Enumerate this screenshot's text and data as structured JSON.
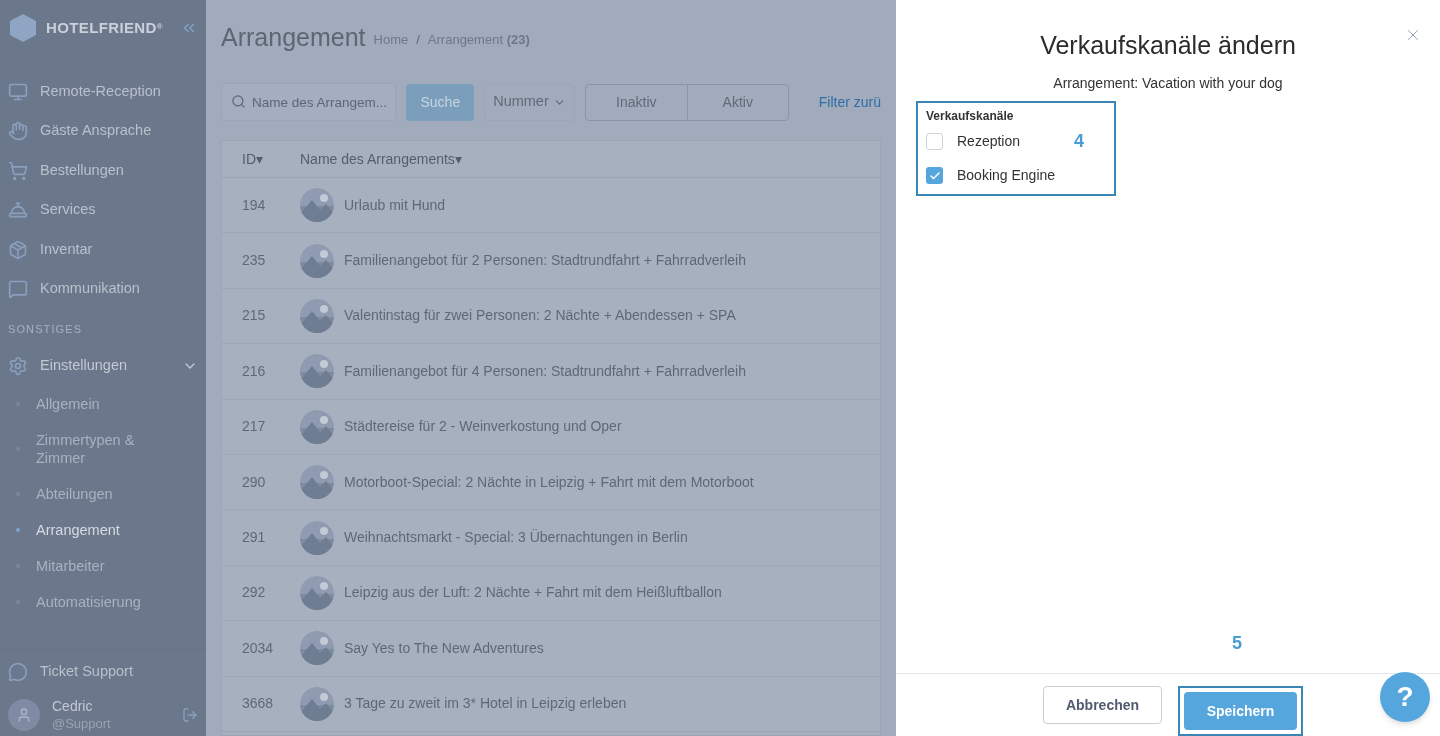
{
  "sidebar": {
    "logo": "HOTELFRIEND",
    "logo_mark": "®",
    "items": [
      {
        "label": "Remote-Reception"
      },
      {
        "label": "Gäste Ansprache"
      },
      {
        "label": "Bestellungen"
      },
      {
        "label": "Services"
      },
      {
        "label": "Inventar"
      },
      {
        "label": "Kommunikation"
      }
    ],
    "section": "SONSTIGES",
    "settings": {
      "label": "Einstellungen",
      "expanded": true,
      "children": [
        {
          "label": "Allgemein",
          "selected": false
        },
        {
          "label": "Zimmertypen & Zimmer",
          "selected": false
        },
        {
          "label": "Abteilungen",
          "selected": false
        },
        {
          "label": "Arrangement",
          "selected": true
        },
        {
          "label": "Mitarbeiter",
          "selected": false
        },
        {
          "label": "Automatisierung",
          "selected": false
        }
      ]
    },
    "support": "Ticket Support",
    "user": {
      "name": "Cedric",
      "role": "@Support"
    }
  },
  "header": {
    "title": "Arrangement",
    "breadcrumb_home": "Home",
    "breadcrumb_separator": "/",
    "breadcrumb_current": "Arrangement",
    "count": "(23)"
  },
  "toolbar": {
    "search_placeholder": "Name des Arrangem...",
    "search_button": "Suche",
    "sort": "Nummer",
    "status_tabs": [
      {
        "label": "Inaktiv",
        "selected": false
      },
      {
        "label": "Aktiv",
        "selected": false
      }
    ],
    "reset": "Filter zurü"
  },
  "table": {
    "columns": [
      "ID",
      "Name des Arrangements"
    ],
    "sort_marks": [
      "▾",
      "▾"
    ],
    "rows": [
      {
        "id": "194",
        "name": "Urlaub mit Hund"
      },
      {
        "id": "235",
        "name": "Familienangebot für 2 Personen: Stadtrundfahrt + Fahrradverleih"
      },
      {
        "id": "215",
        "name": "Valentinstag für zwei Personen: 2 Nächte + Abendessen + SPA"
      },
      {
        "id": "216",
        "name": "Familienangebot für 4 Personen: Stadtrundfahrt + Fahrradverleih"
      },
      {
        "id": "217",
        "name": "Städtereise für 2 - Weinverkostung und Oper"
      },
      {
        "id": "290",
        "name": "Motorboot-Special: 2 Nächte in Leipzig + Fahrt mit dem Motorboot"
      },
      {
        "id": "291",
        "name": "Weihnachtsmarkt - Special: 3 Übernachtungen in Berlin"
      },
      {
        "id": "292",
        "name": "Leipzig aus der Luft: 2 Nächte + Fahrt mit dem Heißluftballon"
      },
      {
        "id": "2034",
        "name": "Say Yes to The New Adventures"
      },
      {
        "id": "3668",
        "name": "3 Tage zu zweit im 3* Hotel in Leipzig erleben"
      }
    ]
  },
  "drawer": {
    "title": "Verkaufskanäle ändern",
    "subtitle": "Arrangement: Vacation with your dog",
    "group_label": "Verkaufskanäle",
    "channels": [
      {
        "label": "Rezeption",
        "checked": false
      },
      {
        "label": "Booking Engine",
        "checked": true
      }
    ],
    "annotations": [
      "4",
      "5"
    ],
    "buttons": [
      {
        "label": "Abbrechen",
        "kind": "secondary"
      },
      {
        "label": "Speichern",
        "kind": "primary"
      }
    ]
  },
  "help": "?"
}
